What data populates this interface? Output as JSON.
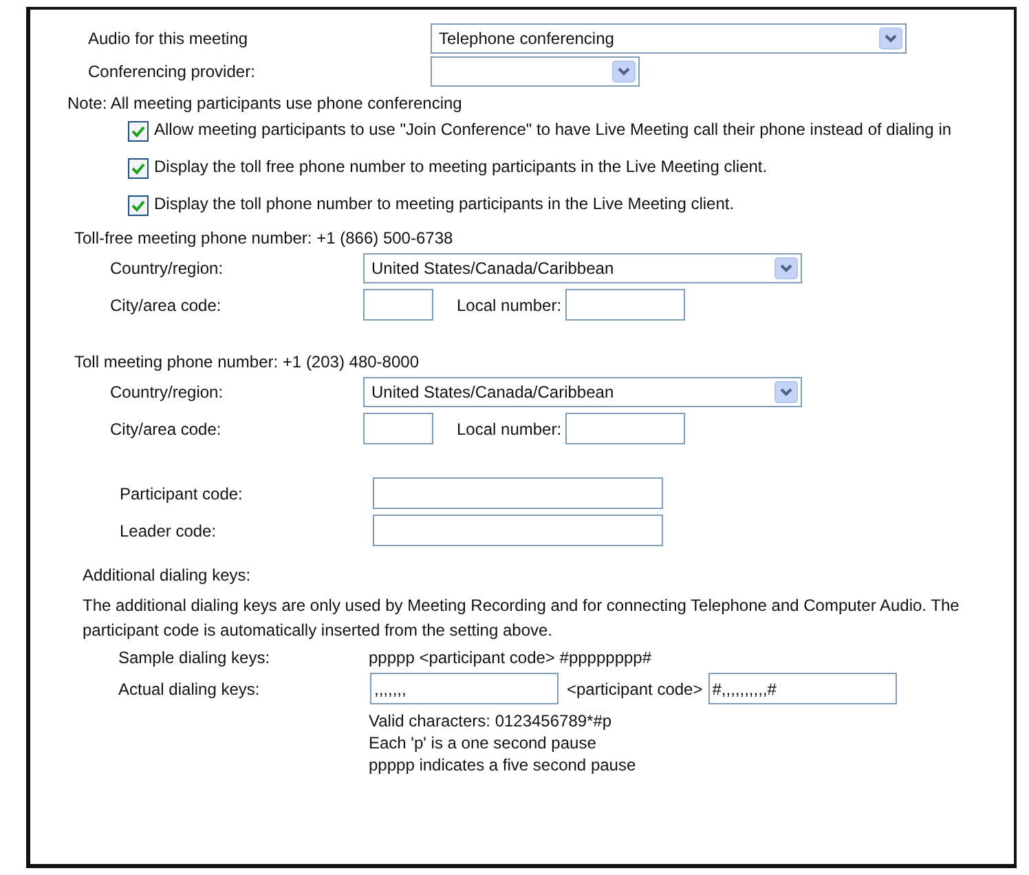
{
  "audio": {
    "label": "Audio for this meeting",
    "value": "Telephone conferencing"
  },
  "provider": {
    "label": "Conferencing provider:"
  },
  "note": "Note: All meeting participants use phone conferencing",
  "options": [
    {
      "label": "Allow meeting participants to use \"Join Conference\" to have Live Meeting call their phone instead of dialing in",
      "checked": true
    },
    {
      "label": "Display the toll free phone number to meeting participants in the Live Meeting client.",
      "checked": true
    },
    {
      "label": "Display the toll phone number to meeting participants in the Live Meeting client.",
      "checked": true
    }
  ],
  "phone_sections": [
    {
      "heading": "Toll-free meeting phone number: +1 (866) 500-6738",
      "country_label": "Country/region:",
      "country": "United States/Canada/Caribbean",
      "city_label": "City/area code:",
      "local_label": "Local number:"
    },
    {
      "heading": "Toll meeting phone number: +1 (203) 480-8000",
      "country_label": "Country/region:",
      "country": "United States/Canada/Caribbean",
      "city_label": "City/area code:",
      "local_label": "Local number:"
    }
  ],
  "codes": [
    {
      "label": "Participant code:"
    },
    {
      "label": "Leader code:"
    }
  ],
  "dialing": {
    "heading": "Additional dialing keys:",
    "description": "The additional dialing keys are only used by Meeting Recording and for connecting Telephone and Computer Audio. The participant code is automatically inserted from the setting above.",
    "sample_label": "Sample dialing keys:",
    "sample": "ppppp <participant code> #pppppppp#",
    "actual_label": "Actual dialing keys:",
    "actual_prefix": ",,,,,,,",
    "middle": "<participant code>",
    "actual_suffix": "#,,,,,,,,,,#",
    "hints": [
      "Valid characters: 0123456789*#p",
      "Each 'p' is a one second pause",
      "ppppp indicates a five second pause"
    ]
  }
}
